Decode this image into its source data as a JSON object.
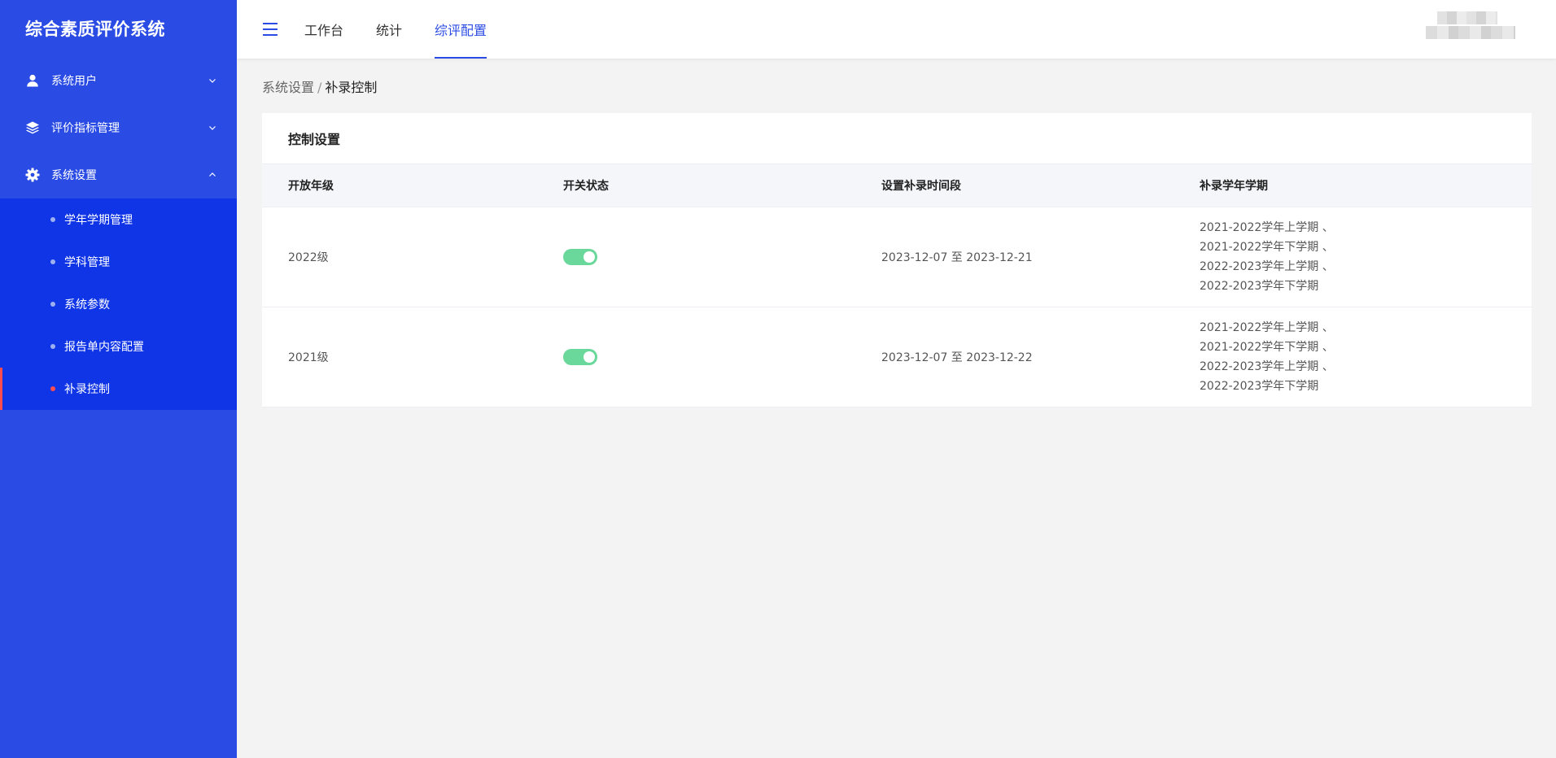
{
  "app": {
    "title": "综合素质评价系统"
  },
  "colors": {
    "sidebar_bg": "#2b4ce4",
    "submenu_bg": "#1035e6",
    "accent": "#2b4ce4",
    "active_marker": "#ff4d4f",
    "toggle_on": "#6ad89b"
  },
  "sidebar": {
    "groups": [
      {
        "label": "系统用户",
        "icon": "user-icon",
        "expanded": false
      },
      {
        "label": "评价指标管理",
        "icon": "layers-icon",
        "expanded": false
      },
      {
        "label": "系统设置",
        "icon": "gear-icon",
        "expanded": true
      }
    ],
    "submenu": [
      {
        "label": "学年学期管理",
        "active": false
      },
      {
        "label": "学科管理",
        "active": false
      },
      {
        "label": "系统参数",
        "active": false
      },
      {
        "label": "报告单内容配置",
        "active": false
      },
      {
        "label": "补录控制",
        "active": true
      }
    ]
  },
  "header": {
    "tabs": [
      {
        "label": "工作台",
        "active": false
      },
      {
        "label": "统计",
        "active": false
      },
      {
        "label": "综评配置",
        "active": true
      }
    ]
  },
  "breadcrumb": {
    "parent": "系统设置",
    "separator": "/",
    "current": "补录控制"
  },
  "card": {
    "title": "控制设置",
    "columns": [
      "开放年级",
      "开关状态",
      "设置补录时间段",
      "补录学年学期"
    ],
    "rows": [
      {
        "grade": "2022级",
        "enabled": true,
        "period": "2023-12-07 至 2023-12-21",
        "semesters": [
          "2021-2022学年上学期 、",
          "2021-2022学年下学期 、",
          "2022-2023学年上学期 、",
          "2022-2023学年下学期"
        ]
      },
      {
        "grade": "2021级",
        "enabled": true,
        "period": "2023-12-07 至 2023-12-22",
        "semesters": [
          "2021-2022学年上学期 、",
          "2021-2022学年下学期 、",
          "2022-2023学年上学期 、",
          "2022-2023学年下学期"
        ]
      }
    ]
  }
}
